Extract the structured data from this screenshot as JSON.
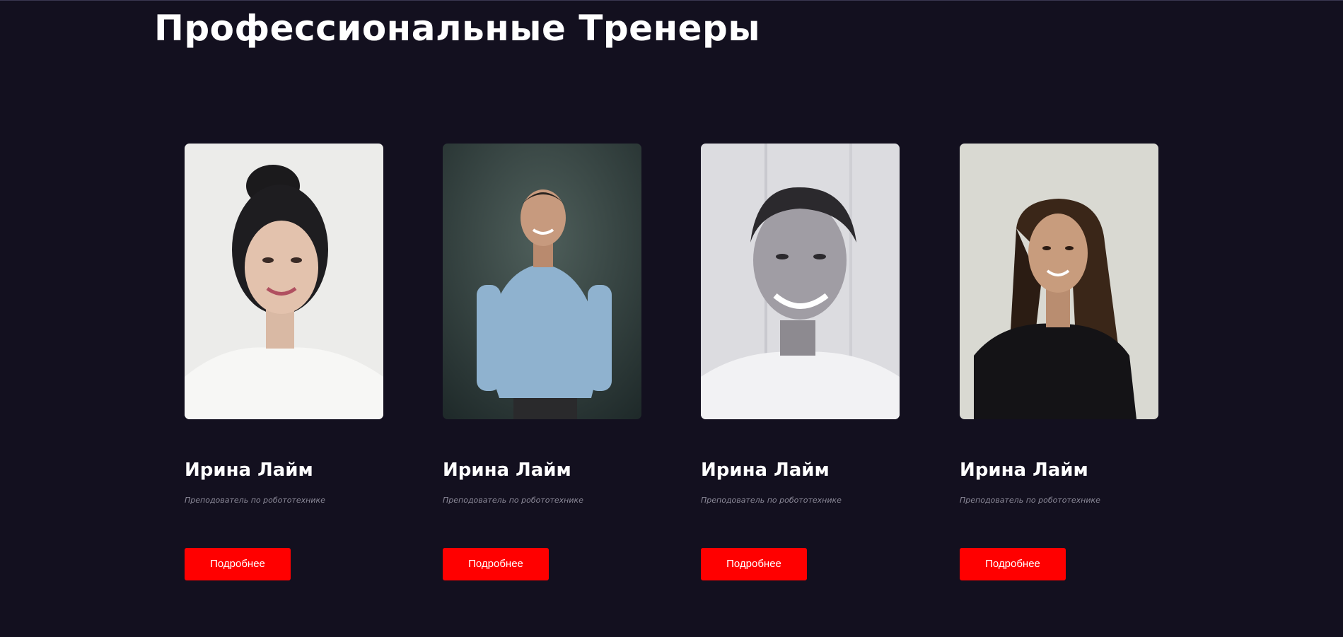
{
  "section": {
    "title": "Профессиональные Тренеры"
  },
  "trainers": [
    {
      "name": "Ирина Лайм",
      "role": "Преподователь по робототехнике",
      "button_label": "Подробнее",
      "photo": "woman-with-bun-white-tshirt"
    },
    {
      "name": "Ирина Лайм",
      "role": "Преподователь по робототехнике",
      "button_label": "Подробнее",
      "photo": "man-blue-shirt-green-background"
    },
    {
      "name": "Ирина Лайм",
      "role": "Преподователь по робототехнике",
      "button_label": "Подробнее",
      "photo": "smiling-man-black-and-white"
    },
    {
      "name": "Ирина Лайм",
      "role": "Преподователь по робототехнике",
      "button_label": "Подробнее",
      "photo": "woman-long-hair-black-top"
    }
  ],
  "colors": {
    "background": "#13101f",
    "accent": "#ff0000",
    "text": "#ffffff",
    "muted_text": "#8c8a99"
  }
}
